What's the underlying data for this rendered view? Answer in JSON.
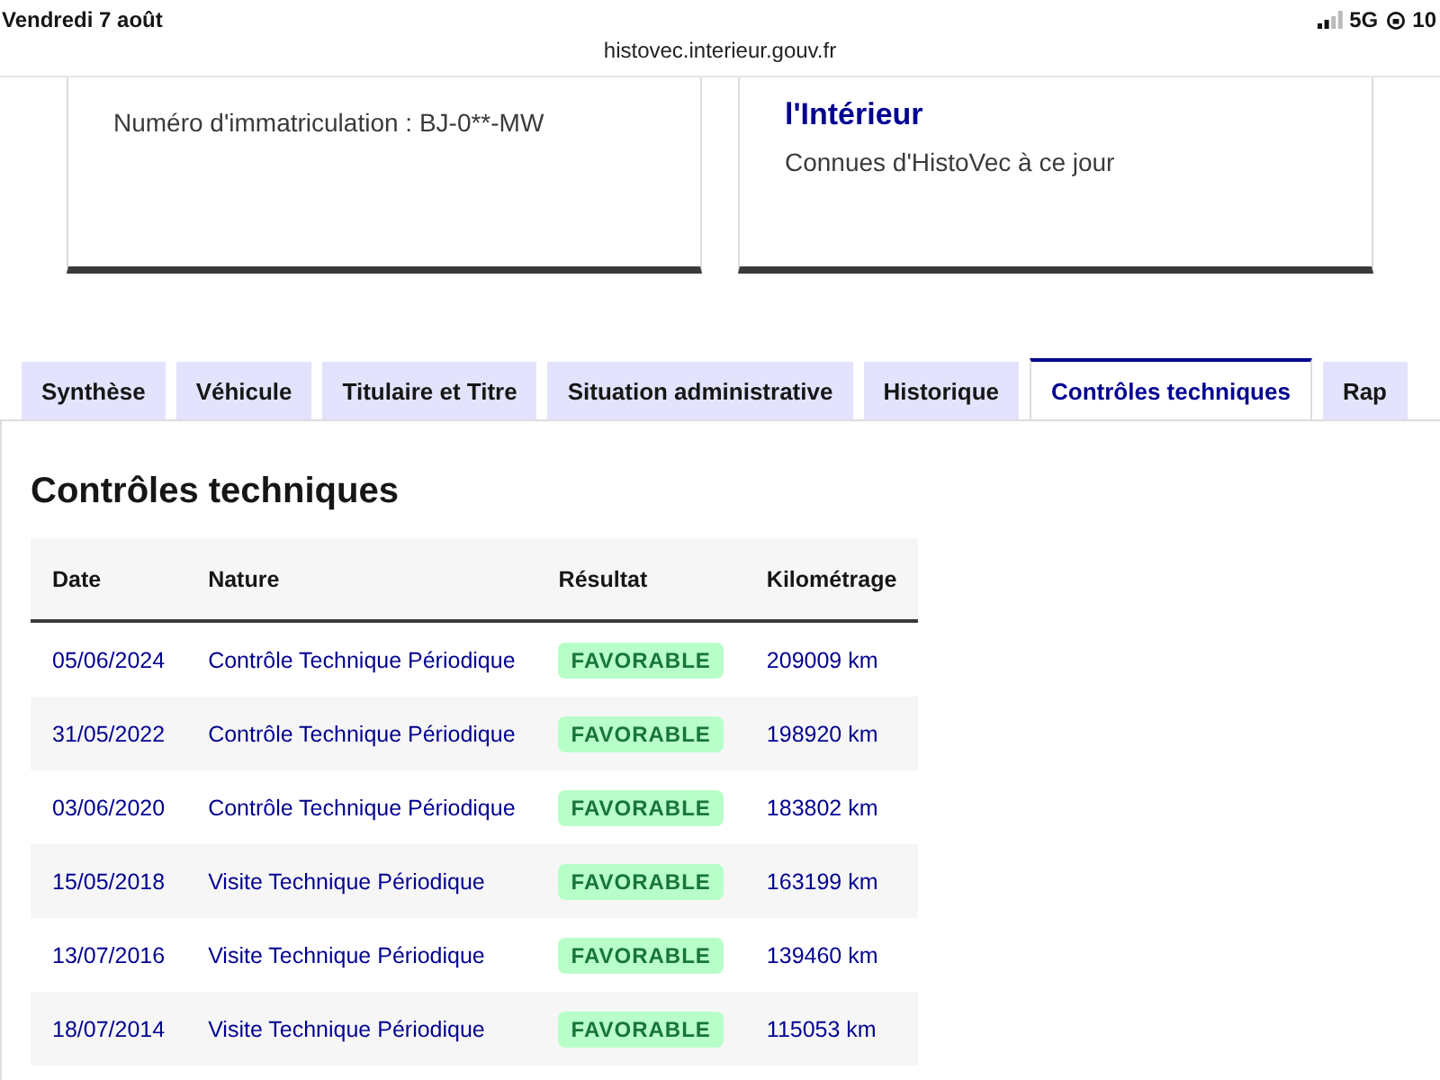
{
  "status_bar": {
    "date": "Vendredi 7 août",
    "network": "5G",
    "battery": "10"
  },
  "address_bar": {
    "url": "histovec.interieur.gouv.fr"
  },
  "cards": [
    {
      "lines": [
        {
          "kind": "text",
          "text": "Numéro d'immatriculation : BJ-0**-MW"
        }
      ]
    },
    {
      "lines": [
        {
          "kind": "heading",
          "text": "l'Intérieur"
        },
        {
          "kind": "text",
          "text": "Connues d'HistoVec à ce jour"
        }
      ]
    }
  ],
  "tabs": [
    {
      "label": "Synthèse",
      "selected": false
    },
    {
      "label": "Véhicule",
      "selected": false
    },
    {
      "label": "Titulaire et Titre",
      "selected": false
    },
    {
      "label": "Situation administrative",
      "selected": false
    },
    {
      "label": "Historique",
      "selected": false
    },
    {
      "label": "Contrôles techniques",
      "selected": true
    },
    {
      "label": "Rap",
      "selected": false
    }
  ],
  "section": {
    "title": "Contrôles techniques",
    "table": {
      "columns": [
        "Date",
        "Nature",
        "Résultat",
        "Kilométrage"
      ],
      "rows": [
        {
          "date": "05/06/2024",
          "nature": "Contrôle Technique Périodique",
          "result": "FAVORABLE",
          "mileage": "209009 km"
        },
        {
          "date": "31/05/2022",
          "nature": "Contrôle Technique Périodique",
          "result": "FAVORABLE",
          "mileage": "198920 km"
        },
        {
          "date": "03/06/2020",
          "nature": "Contrôle Technique Périodique",
          "result": "FAVORABLE",
          "mileage": "183802 km"
        },
        {
          "date": "15/05/2018",
          "nature": "Visite Technique Périodique",
          "result": "FAVORABLE",
          "mileage": "163199 km"
        },
        {
          "date": "13/07/2016",
          "nature": "Visite Technique Périodique",
          "result": "FAVORABLE",
          "mileage": "139460 km"
        },
        {
          "date": "18/07/2014",
          "nature": "Visite Technique Périodique",
          "result": "FAVORABLE",
          "mileage": "115053 km"
        }
      ]
    }
  }
}
